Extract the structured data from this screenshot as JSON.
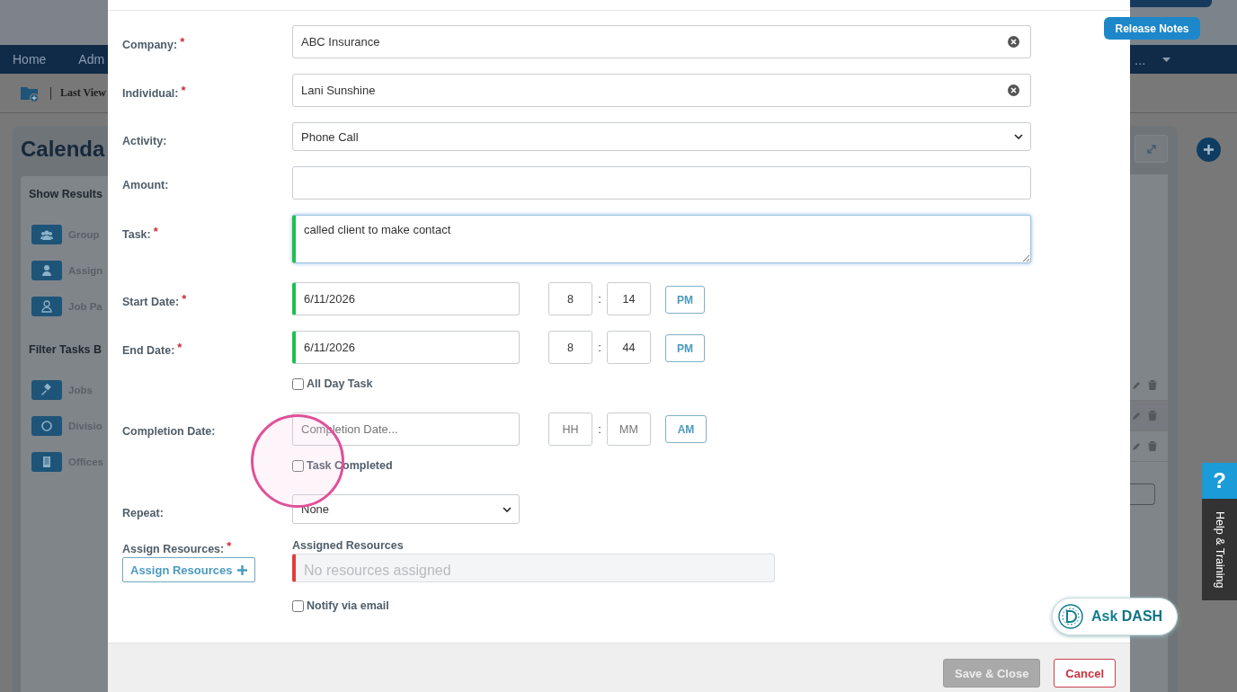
{
  "background": {
    "nav": [
      "Home",
      "Adm"
    ],
    "nav_more": "...",
    "breadcrumb": "Last View",
    "page_title": "Calenda",
    "show_results": {
      "heading": "Show Results",
      "items": [
        {
          "label": "Group"
        },
        {
          "label": "Assign"
        },
        {
          "label": "Job Pa"
        }
      ]
    },
    "filter": {
      "heading": "Filter Tasks B",
      "items": [
        {
          "label": "Jobs"
        },
        {
          "label": "Divisio"
        },
        {
          "label": "Offices"
        }
      ]
    }
  },
  "release_notes": "Release Notes",
  "form": {
    "fields": [
      {
        "kind": "text",
        "label": "Company:",
        "required_mark": "*",
        "value": "ABC Insurance",
        "clearable": true
      },
      {
        "kind": "text",
        "label": "Individual:",
        "required_mark": "*",
        "value": "Lani Sunshine",
        "clearable": true
      },
      {
        "kind": "select",
        "label": "Activity:",
        "value": "Phone Call",
        "wide": true
      },
      {
        "kind": "text",
        "label": "Amount:",
        "clearable": false
      },
      {
        "kind": "textarea",
        "label": "Task:",
        "required_mark": "*",
        "value": "called client to make contact",
        "valid": true,
        "focused": true
      },
      {
        "kind": "datetime",
        "label": "Start Date:",
        "required_mark": "*",
        "date": "6/11/2026",
        "hour": "8",
        "separator": ":",
        "minute": "14",
        "meridiem": "PM",
        "valid": true
      },
      {
        "kind": "datetime",
        "label": "End Date:",
        "required_mark": "*",
        "date": "6/11/2026",
        "hour": "8",
        "separator": ":",
        "minute": "44",
        "meridiem": "PM",
        "valid": true,
        "checkbox": {
          "label": "All Day Task",
          "checked": false
        }
      },
      {
        "kind": "datetime",
        "label": "Completion Date:",
        "date_placeholder": "Completion Date...",
        "hour_placeholder": "HH",
        "separator": ":",
        "minute_placeholder": "MM",
        "meridiem": "AM",
        "checkbox": {
          "label": "Task Completed",
          "checked": false
        }
      },
      {
        "kind": "select",
        "label": "Repeat:",
        "value": "None",
        "wide": false
      },
      {
        "kind": "resources",
        "label": "Assign Resources:",
        "required_mark": "*",
        "button": "Assign Resources",
        "list_label": "Assigned Resources",
        "empty_text": "No resources assigned",
        "valid": false,
        "checkbox": {
          "label": "Notify via email",
          "checked": false
        }
      }
    ]
  },
  "footer": {
    "buttons": [
      {
        "label": "Save & Close",
        "kind": "save",
        "disabled": true
      },
      {
        "label": "Cancel",
        "kind": "cancel",
        "disabled": false
      }
    ]
  },
  "help_tab": {
    "icon": "?",
    "label": "Help & Training"
  },
  "ask_button": {
    "label": "Ask",
    "emphasis": "DASH"
  }
}
